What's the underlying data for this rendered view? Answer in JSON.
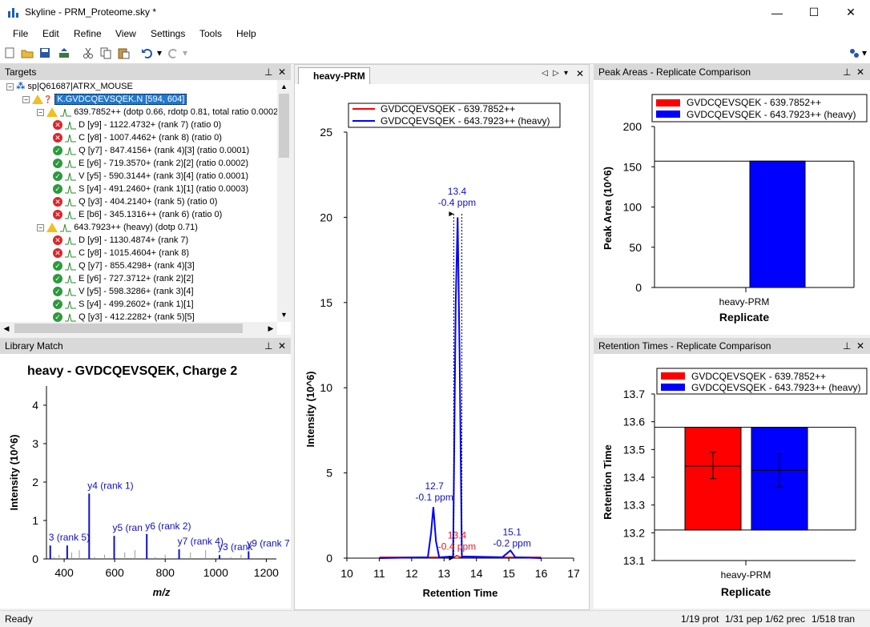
{
  "window": {
    "title": "Skyline - PRM_Proteome.sky *",
    "minimize": "—",
    "maximize": "☐",
    "close": "✕"
  },
  "menu": [
    "File",
    "Edit",
    "Refine",
    "View",
    "Settings",
    "Tools",
    "Help"
  ],
  "targets": {
    "title": "Targets",
    "rows": [
      {
        "indent": 0,
        "icon": "protein",
        "text": "sp|Q61687|ATRX_MOUSE",
        "selected": false
      },
      {
        "indent": 1,
        "icon": "peptide",
        "text": "K.GVDCQEVSQEK.N [594, 604]",
        "selected": true
      },
      {
        "indent": 2,
        "icon": "warn",
        "text": "639.7852++ (dotp 0.66, rdotp 0.81, total ratio 0.0002",
        "selected": false
      },
      {
        "indent": 3,
        "icon": "x",
        "text": "D [y9] - 1122.4732+ (rank 7) (ratio 0)"
      },
      {
        "indent": 3,
        "icon": "x",
        "text": "C [y8] - 1007.4462+ (rank 8) (ratio 0)"
      },
      {
        "indent": 3,
        "icon": "ok",
        "text": "Q [y7] - 847.4156+ (rank 4)[3] (ratio 0.0001)"
      },
      {
        "indent": 3,
        "icon": "ok",
        "text": "E [y6] - 719.3570+ (rank 2)[2] (ratio 0.0002)"
      },
      {
        "indent": 3,
        "icon": "ok",
        "text": "V [y5] - 590.3144+ (rank 3)[4] (ratio 0.0001)"
      },
      {
        "indent": 3,
        "icon": "ok",
        "text": "S [y4] - 491.2460+ (rank 1)[1] (ratio 0.0003)"
      },
      {
        "indent": 3,
        "icon": "x",
        "text": "Q [y3] - 404.2140+ (rank 5) (ratio 0)"
      },
      {
        "indent": 3,
        "icon": "x",
        "text": "E [b6] - 345.1316++ (rank 6) (ratio 0)"
      },
      {
        "indent": 2,
        "icon": "warn",
        "text": "643.7923++ (heavy) (dotp 0.71)"
      },
      {
        "indent": 3,
        "icon": "x",
        "text": "D [y9] - 1130.4874+ (rank 7)"
      },
      {
        "indent": 3,
        "icon": "x",
        "text": "C [y8] - 1015.4604+ (rank 8)"
      },
      {
        "indent": 3,
        "icon": "ok",
        "text": "Q [y7] - 855.4298+ (rank 4)[3]"
      },
      {
        "indent": 3,
        "icon": "ok",
        "text": "E [y6] - 727.3712+ (rank 2)[2]"
      },
      {
        "indent": 3,
        "icon": "ok",
        "text": "V [y5] - 598.3286+ (rank 3)[4]"
      },
      {
        "indent": 3,
        "icon": "ok",
        "text": "S [y4] - 499.2602+ (rank 1)[1]"
      },
      {
        "indent": 3,
        "icon": "ok",
        "text": "Q [y3] - 412.2282+ (rank 5)[5]"
      }
    ]
  },
  "library": {
    "title": "Library Match",
    "chart_title": "heavy - GVDCQEVSQEK, Charge 2",
    "ylabel": "Intensity (10^6)",
    "xlabel": "m/z",
    "xticks": [
      400,
      600,
      800,
      1000,
      1200
    ],
    "yticks": [
      0,
      1,
      2,
      3,
      4
    ],
    "peaks": [
      {
        "x": 345,
        "y": 0.35,
        "label": "3 (rank 5)",
        "color": "#1010c0"
      },
      {
        "x": 412,
        "y": 0.35,
        "label": "",
        "color": "#1010c0"
      },
      {
        "x": 499,
        "y": 1.7,
        "label": "y4 (rank 1)",
        "color": "#1010c0"
      },
      {
        "x": 598,
        "y": 0.6,
        "label": "y5 (ran",
        "color": "#1010c0"
      },
      {
        "x": 727,
        "y": 0.65,
        "label": "y6 (rank 2)",
        "color": "#1010c0"
      },
      {
        "x": 855,
        "y": 0.25,
        "label": "y7 (rank 4)",
        "color": "#1010c0"
      },
      {
        "x": 1015,
        "y": 0.1,
        "label": "y3 (rank",
        "color": "#1010c0"
      },
      {
        "x": 1130,
        "y": 0.2,
        "label": "y9 (rank 7",
        "color": "#1010c0"
      }
    ]
  },
  "chrom": {
    "tab": "heavy-PRM",
    "ylabel": "Intensity (10^6)",
    "xlabel": "Retention Time",
    "xticks": [
      10,
      11,
      12,
      13,
      14,
      15,
      16,
      17
    ],
    "yticks": [
      0,
      5,
      10,
      15,
      20,
      25
    ],
    "legend": [
      "GVDCQEVSQEK - 639.7852++",
      "GVDCQEVSQEK - 643.7923++ (heavy)"
    ],
    "annotations": [
      {
        "x": 13.4,
        "y": 20.5,
        "line1": "13.4",
        "line2": "-0.4 ppm",
        "color": "#1010c0"
      },
      {
        "x": 12.7,
        "y": 3.2,
        "line1": "12.7",
        "line2": "-0.1 ppm",
        "color": "#1010c0"
      },
      {
        "x": 13.4,
        "y": 0.3,
        "line1": "13.4",
        "line2": "-0.4 ppm",
        "color": "#e02020"
      },
      {
        "x": 15.1,
        "y": 0.5,
        "line1": "15.1",
        "line2": "-0.2 ppm",
        "color": "#1010c0"
      }
    ]
  },
  "peak_areas": {
    "title": "Peak Areas - Replicate Comparison",
    "legend": [
      "GVDCQEVSQEK - 639.7852++",
      "GVDCQEVSQEK - 643.7923++ (heavy)"
    ],
    "ylabel": "Peak Area (10^6)",
    "xlabel": "Replicate",
    "category": "heavy-PRM",
    "yticks": [
      0,
      50,
      100,
      150,
      200
    ],
    "values": [
      0,
      157
    ]
  },
  "retention": {
    "title": "Retention Times - Replicate Comparison",
    "legend": [
      "GVDCQEVSQEK - 639.7852++",
      "GVDCQEVSQEK - 643.7923++ (heavy)"
    ],
    "ylabel": "Retention Time",
    "xlabel": "Replicate",
    "category": "heavy-PRM",
    "yticks": [
      13.1,
      13.2,
      13.3,
      13.4,
      13.5,
      13.6,
      13.7
    ],
    "values": [
      13.58,
      13.58
    ],
    "means": [
      13.44,
      13.425
    ],
    "err_low": [
      13.395,
      13.365
    ],
    "err_high": [
      13.49,
      13.485
    ]
  },
  "status": {
    "ready": "Ready",
    "prot": "1/19 prot",
    "pep": "1/31 pep",
    "prec": "1/62 prec",
    "tran": "1/518 tran"
  },
  "colors": {
    "red": "#ff0000",
    "blue": "#0000ff"
  }
}
